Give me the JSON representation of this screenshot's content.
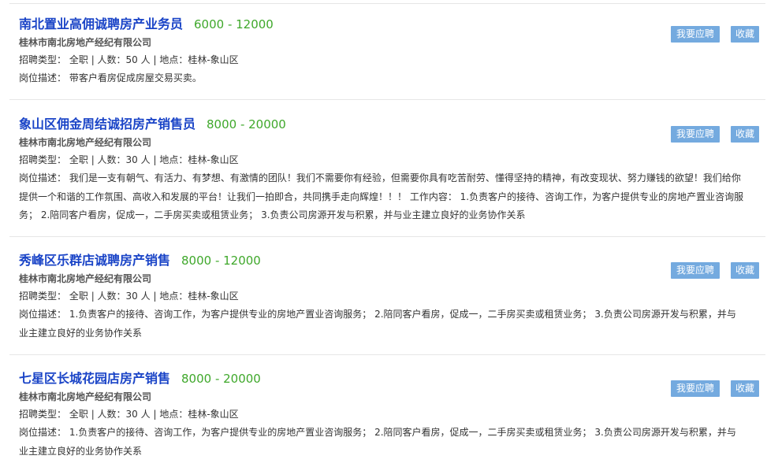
{
  "labels": {
    "type": "招聘类型：",
    "desc": "岗位描述：",
    "apply": "我要应聘",
    "favorite": "收藏"
  },
  "jobs": [
    {
      "title": "南北置业高佣诚聘房产业务员",
      "salary": "6000 - 12000",
      "company": "桂林市南北房地产经纪有限公司",
      "type": "全职",
      "count": "人数：50 人",
      "location": "地点：桂林-象山区",
      "description": "带客户看房促成房屋交易买卖。"
    },
    {
      "title": "象山区佣金周结诚招房产销售员",
      "salary": "8000 - 20000",
      "company": "桂林市南北房地产经纪有限公司",
      "type": "全职",
      "count": "人数：30 人",
      "location": "地点：桂林-象山区",
      "description": "我们是一支有朝气、有活力、有梦想、有激情的团队！我们不需要你有经验，但需要你具有吃苦耐劳、懂得坚持的精神，有改变现状、努力赚钱的欲望！我们给你提供一个和谐的工作氛围、高收入和发展的平台！让我们一拍即合，共同携手走向辉煌！！！ 工作内容： 1.负责客户的接待、咨询工作，为客户提供专业的房地产置业咨询服务； 2.陪同客户看房，促成一，二手房买卖或租赁业务； 3.负责公司房源开发与积累，并与业主建立良好的业务协作关系"
    },
    {
      "title": "秀峰区乐群店诚聘房产销售",
      "salary": "8000 - 12000",
      "company": "桂林市南北房地产经纪有限公司",
      "type": "全职",
      "count": "人数：30 人",
      "location": "地点：桂林-象山区",
      "description": "1.负责客户的接待、咨询工作，为客户提供专业的房地产置业咨询服务； 2.陪同客户看房，促成一，二手房买卖或租赁业务； 3.负责公司房源开发与积累，并与业主建立良好的业务协作关系"
    },
    {
      "title": "七星区长城花园店房产销售",
      "salary": "8000 - 20000",
      "company": "桂林市南北房地产经纪有限公司",
      "type": "全职",
      "count": "人数：30 人",
      "location": "地点：桂林-象山区",
      "description": "1.负责客户的接待、咨询工作，为客户提供专业的房地产置业咨询服务； 2.陪同客户看房，促成一，二手房买卖或租赁业务； 3.负责公司房源开发与积累，并与业主建立良好的业务协作关系"
    }
  ]
}
